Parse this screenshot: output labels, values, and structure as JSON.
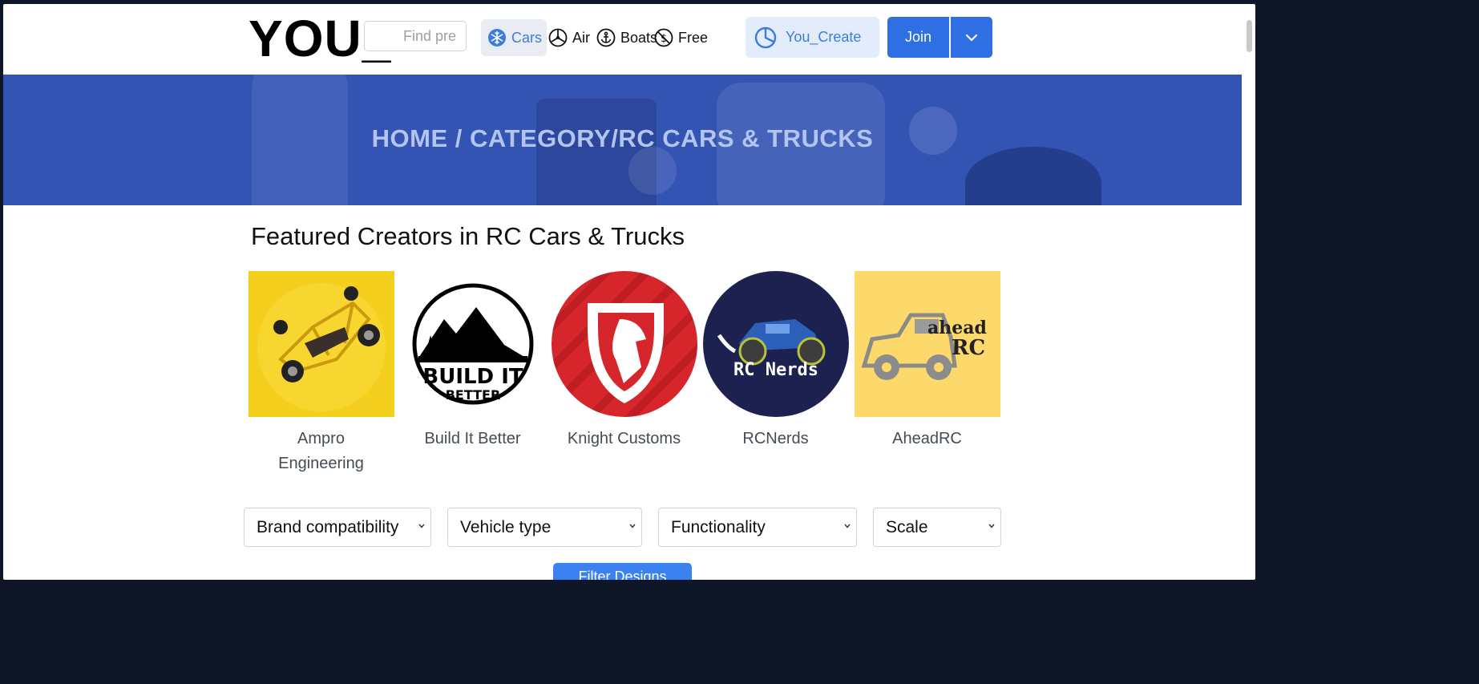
{
  "header": {
    "logo_text": "YOU_",
    "search_placeholder": "Find pre",
    "nav": [
      {
        "label": "Cars",
        "icon": "snowflake-icon",
        "active": true
      },
      {
        "label": "Air",
        "icon": "propeller-icon"
      },
      {
        "label": "Boats",
        "icon": "anchor-icon"
      },
      {
        "label": "Free",
        "icon": "no-dollar-icon"
      }
    ],
    "create_label": "You_Create",
    "join_label": "Join"
  },
  "banner": {
    "crumbs": [
      "HOME",
      " / ",
      "CATEGORY",
      "/",
      "RC CARS & TRUCKS"
    ]
  },
  "section_title": "Featured Creators in RC Cars & Trucks",
  "creators": [
    {
      "name": "Ampro Engineering"
    },
    {
      "name": "Build It Better",
      "logo_text": [
        "BUILD IT",
        "BETTER"
      ]
    },
    {
      "name": "Knight Customs"
    },
    {
      "name": "RCNerds",
      "logo_text": "RC Nerds"
    },
    {
      "name": "AheadRC",
      "logo_text": [
        "ahead",
        "RC"
      ]
    }
  ],
  "filters": [
    "Brand compatibility",
    "Vehicle type",
    "Functionality",
    "Scale"
  ],
  "filter_button_label": "Filter Designs",
  "colors": {
    "accent": "#2f6fe4",
    "banner": "#3454b4",
    "active_nav": "#3b7ddd"
  }
}
